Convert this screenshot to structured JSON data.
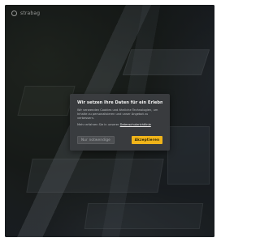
{
  "site": {
    "logo_text": "strabag"
  },
  "consent": {
    "title": "Wir setzen Ihre Daten für ein Erlebnis",
    "description": "Wir verwenden Cookies und ähnliche Technologien, um Inhalte zu personalisieren und unser Angebot zu verbessern.",
    "link_prefix": "Mehr erfahren Sie in unserer",
    "link_label": "Datenschutzrichtlinie",
    "decline_label": "Nur notwendige",
    "accept_label": "Akzeptieren"
  },
  "colors": {
    "accent": "#f0b41a",
    "modal_bg": "#3a3c3f",
    "overlay": "#0a0c0e"
  }
}
